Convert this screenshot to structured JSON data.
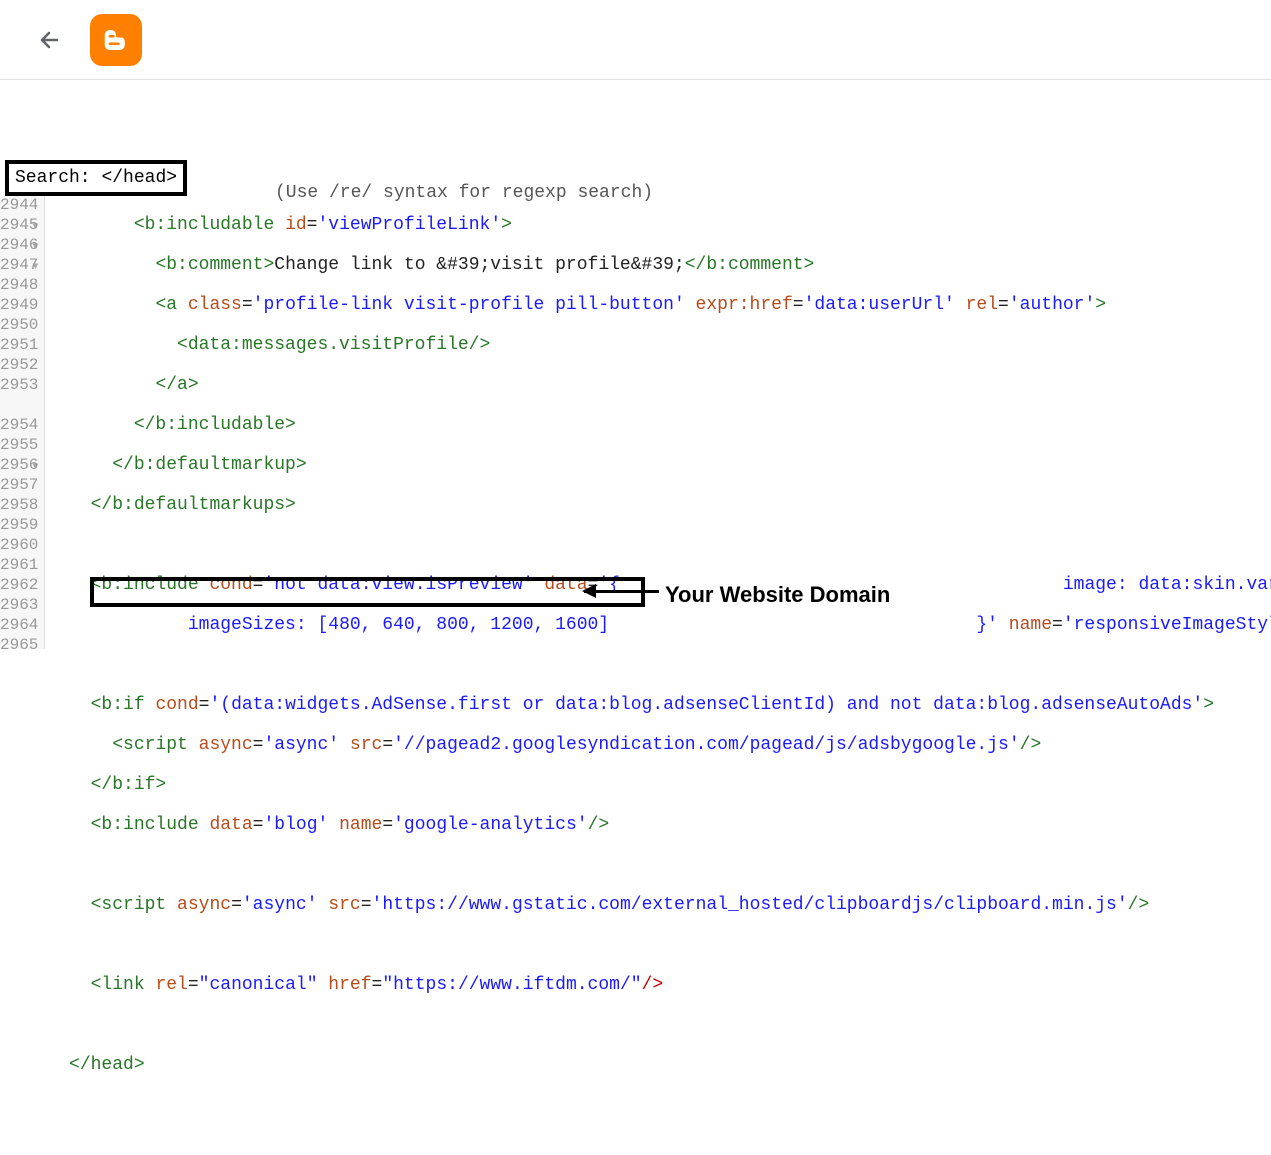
{
  "header": {
    "back_label": "back"
  },
  "search": {
    "label": "Search:",
    "value": "</head>",
    "hint": "(Use /re/ syntax for regexp search)"
  },
  "annotation": {
    "text": "Your Website Domain"
  },
  "lines": [
    {
      "num": "2944",
      "fold": "▼"
    },
    {
      "num": "2945",
      "fold": "▼"
    },
    {
      "num": "2946",
      "fold": "▼"
    },
    {
      "num": "2947"
    },
    {
      "num": "2948"
    },
    {
      "num": "2949"
    },
    {
      "num": "2950"
    },
    {
      "num": "2951"
    },
    {
      "num": "2952"
    },
    {
      "num": "2953"
    },
    {
      "num": "2954"
    },
    {
      "num": "2955",
      "fold": "▼"
    },
    {
      "num": "2956"
    },
    {
      "num": "2957"
    },
    {
      "num": "2958"
    },
    {
      "num": "2959"
    },
    {
      "num": "2960"
    },
    {
      "num": "2961"
    },
    {
      "num": "2962"
    },
    {
      "num": "2963"
    },
    {
      "num": "2964"
    },
    {
      "num": "2965"
    }
  ],
  "code": {
    "l2944_pad": "        ",
    "l2944_tag": "<b:includable",
    "l2944_a1": " id",
    "l2944_eq": "=",
    "l2944_v1": "'viewProfileLink'",
    "l2944_end": ">",
    "l2945_pad": "          ",
    "l2945_open": "<b:comment>",
    "l2945_txt": "Change link to &#39;visit profile&#39;",
    "l2945_close": "</b:comment>",
    "l2946_pad": "          ",
    "l2946_tag": "<a",
    "l2946_a1": " class",
    "l2946_v1": "'profile-link visit-profile pill-button'",
    "l2946_a2": " expr:href",
    "l2946_v2": "'data:userUrl'",
    "l2946_a3": " rel",
    "l2946_v3": "'author'",
    "l2946_end": ">",
    "l2947_pad": "            ",
    "l2947_tag": "<data:messages.visitProfile/>",
    "l2948_pad": "          ",
    "l2948_tag": "</a>",
    "l2949_pad": "        ",
    "l2949_tag": "</b:includable>",
    "l2950_pad": "      ",
    "l2950_tag": "</b:defaultmarkup>",
    "l2951_pad": "    ",
    "l2951_tag": "</b:defaultmarkups>",
    "l2952": "",
    "l2953_pad": "    ",
    "l2953_tag": "<b:include",
    "l2953_a1": " cond",
    "l2953_v1": "'not data:view.isPreview'",
    "l2953_a2": " data",
    "l2953_v2a": "'{                                         image: data:skin.vars.body_background.image,",
    "l2953b_pad": "             ",
    "l2953b_v": "imageSizes: [480, 640, 800, 1200, 1600]                                  }'",
    "l2953b_a3": " name",
    "l2953b_v3": "'responsiveImageStyle'",
    "l2953b_end": "/>",
    "l2954": "",
    "l2955_pad": "    ",
    "l2955_tag": "<b:if",
    "l2955_a1": " cond",
    "l2955_v1": "'(data:widgets.AdSense.first or data:blog.adsenseClientId) and not data:blog.adsenseAutoAds'",
    "l2955_end": ">",
    "l2956_pad": "      ",
    "l2956_tag": "<script",
    "l2956_a1": " async",
    "l2956_v1": "'async'",
    "l2956_a2": " src",
    "l2956_v2": "'//pagead2.googlesyndication.com/pagead/js/adsbygoogle.js'",
    "l2956_end": "/>",
    "l2957_pad": "    ",
    "l2957_tag": "</b:if>",
    "l2958_pad": "    ",
    "l2958_tag": "<b:include",
    "l2958_a1": " data",
    "l2958_v1": "'blog'",
    "l2958_a2": " name",
    "l2958_v2": "'google-analytics'",
    "l2958_end": "/>",
    "l2959": "",
    "l2960_pad": "    ",
    "l2960_tag": "<script",
    "l2960_a1": " async",
    "l2960_v1": "'async'",
    "l2960_a2": " src",
    "l2960_v2": "'https://www.gstatic.com/external_hosted/clipboardjs/clipboard.min.js'",
    "l2960_end": "/>",
    "l2961": "",
    "l2962_pad": "    ",
    "l2962_tag": "<link",
    "l2962_a1": " rel",
    "l2962_v1": "\"canonical\"",
    "l2962_a2": " href",
    "l2962_v2": "\"https://www.iftdm.com/\"",
    "l2962_end": "/>",
    "l2963": "",
    "l2964_pad": "  ",
    "l2964_tag": "</head>",
    "l2965": ""
  }
}
